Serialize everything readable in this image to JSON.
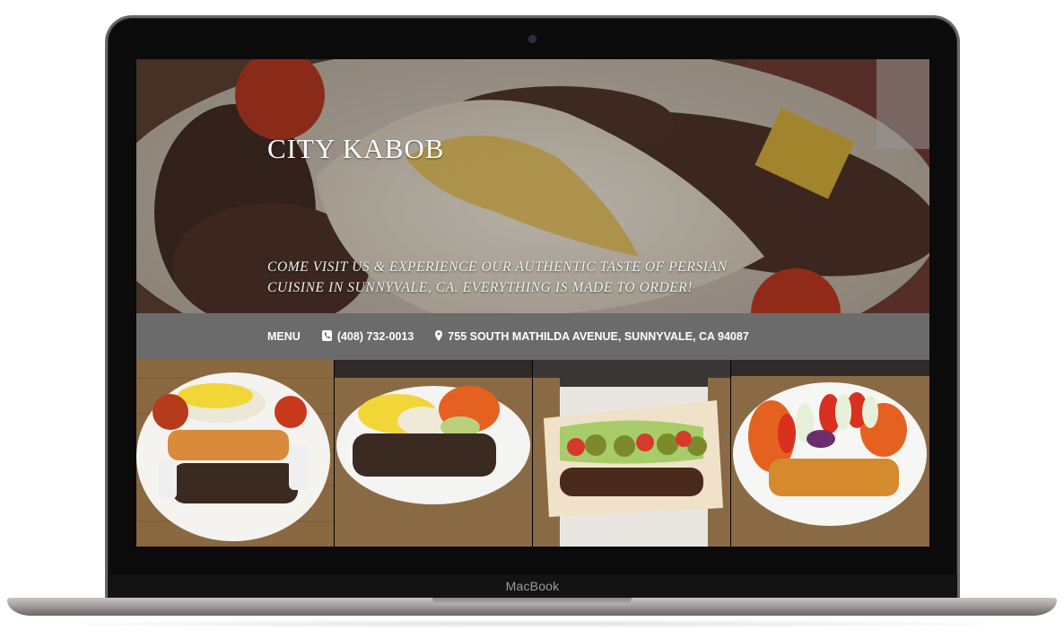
{
  "device": {
    "chin_label": "MacBook"
  },
  "hero": {
    "title": "CITY KABOB",
    "tagline": "COME VISIT US & EXPERIENCE OUR AUTHENTIC TASTE OF PERSIAN CUISINE IN SUNNYVALE, CA. EVERYTHING IS MADE TO ORDER!"
  },
  "nav": {
    "menu_label": "MENU",
    "phone": "(408) 732-0013",
    "address": "755 SOUTH MATHILDA AVENUE, SUNNYVALE, CA 94087",
    "phone_icon": "phone-icon",
    "address_icon": "map-pin-icon"
  },
  "colors": {
    "navbar": "#6b6b6b",
    "text": "#ffffff"
  }
}
